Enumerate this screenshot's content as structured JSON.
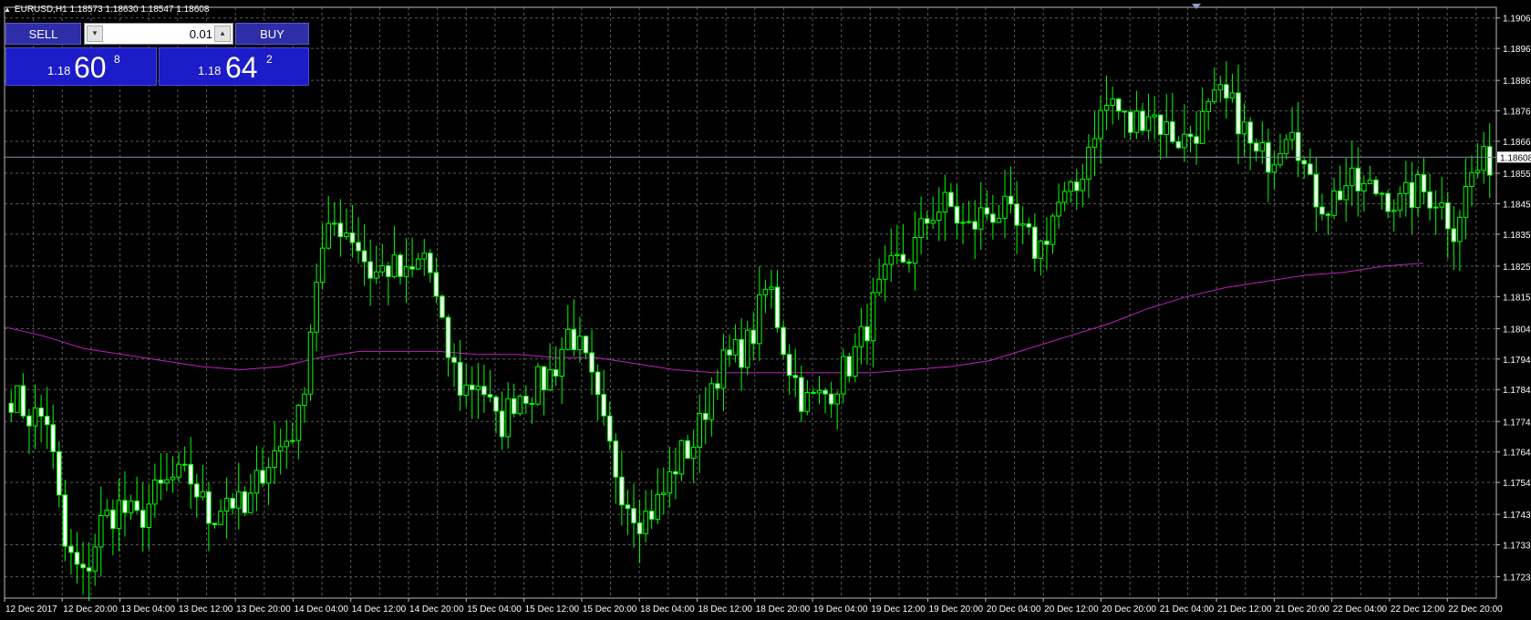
{
  "header": {
    "title": "EURUSD,H1  1.18573 1.18630 1.18547 1.18608"
  },
  "trade_panel": {
    "sell_label": "SELL",
    "buy_label": "BUY",
    "lot_value": "0.01",
    "sell_prefix": "1.18",
    "sell_big": "60",
    "sell_sup": "8",
    "buy_prefix": "1.18",
    "buy_big": "64",
    "buy_sup": "2"
  },
  "colors": {
    "background": "#000000",
    "candle": "#00ff00",
    "bull_fill": "#000000",
    "bear_fill": "#ffffff",
    "grid": "#5a5a5a",
    "ma": "#c020c0",
    "bid_line": "#7a8aa0",
    "axis_text": "#ffffff"
  },
  "chart_data": {
    "type": "candlestick",
    "symbol": "EURUSD",
    "timeframe": "H1",
    "ylim": [
      1.1716,
      1.191
    ],
    "y_ticks": [
      "1.19065",
      "1.18965",
      "1.18860",
      "1.18760",
      "1.18660",
      "1.18555",
      "1.18455",
      "1.18355",
      "1.18250",
      "1.18150",
      "1.18045",
      "1.17945",
      "1.17845",
      "1.17740",
      "1.17640",
      "1.17540",
      "1.17435",
      "1.17335",
      "1.17230"
    ],
    "x_ticks": [
      "12 Dec 2017",
      "12 Dec 20:00",
      "13 Dec 04:00",
      "13 Dec 12:00",
      "13 Dec 20:00",
      "14 Dec 04:00",
      "14 Dec 12:00",
      "14 Dec 20:00",
      "15 Dec 04:00",
      "15 Dec 12:00",
      "15 Dec 20:00",
      "18 Dec 04:00",
      "18 Dec 12:00",
      "18 Dec 20:00",
      "19 Dec 04:00",
      "19 Dec 12:00",
      "19 Dec 20:00",
      "20 Dec 04:00",
      "20 Dec 12:00",
      "20 Dec 20:00",
      "21 Dec 04:00",
      "21 Dec 12:00",
      "21 Dec 20:00",
      "22 Dec 04:00",
      "22 Dec 12:00",
      "22 Dec 20:00"
    ],
    "current_price": "1.18608",
    "close_keypoints": [
      1.1783,
      1.1776,
      1.1775,
      1.1732,
      1.1722,
      1.1741,
      1.1746,
      1.1741,
      1.175,
      1.1755,
      1.1755,
      1.1742,
      1.175,
      1.1743,
      1.176,
      1.1766,
      1.1775,
      1.1825,
      1.184,
      1.1835,
      1.1822,
      1.1825,
      1.182,
      1.183,
      1.18,
      1.1784,
      1.1788,
      1.1771,
      1.1783,
      1.1785,
      1.179,
      1.1805,
      1.179,
      1.1768,
      1.175,
      1.1742,
      1.1748,
      1.1762,
      1.1768,
      1.179,
      1.1795,
      1.18,
      1.182,
      1.1795,
      1.178,
      1.1782,
      1.1789,
      1.1798,
      1.1815,
      1.1825,
      1.183,
      1.1843,
      1.1845,
      1.1836,
      1.1843,
      1.1843,
      1.1835,
      1.183,
      1.1845,
      1.1848,
      1.187,
      1.188,
      1.187,
      1.1877,
      1.187,
      1.1866,
      1.1872,
      1.188,
      1.1875,
      1.186,
      1.1862,
      1.1875,
      1.185,
      1.1845,
      1.1852,
      1.185,
      1.185,
      1.1845,
      1.185,
      1.1848,
      1.1838,
      1.1855,
      1.186
    ],
    "ma_keypoints": [
      1.1805,
      1.1802,
      1.1798,
      1.1796,
      1.1794,
      1.1792,
      1.1791,
      1.1792,
      1.1795,
      1.1797,
      1.1797,
      1.1797,
      1.1796,
      1.1796,
      1.1795,
      1.1795,
      1.1793,
      1.1791,
      1.179,
      1.179,
      1.179,
      1.179,
      1.179,
      1.1791,
      1.1792,
      1.1794,
      1.1798,
      1.1802,
      1.1806,
      1.1811,
      1.1815,
      1.1818,
      1.182,
      1.1822,
      1.1823,
      1.1825,
      1.1826
    ]
  }
}
